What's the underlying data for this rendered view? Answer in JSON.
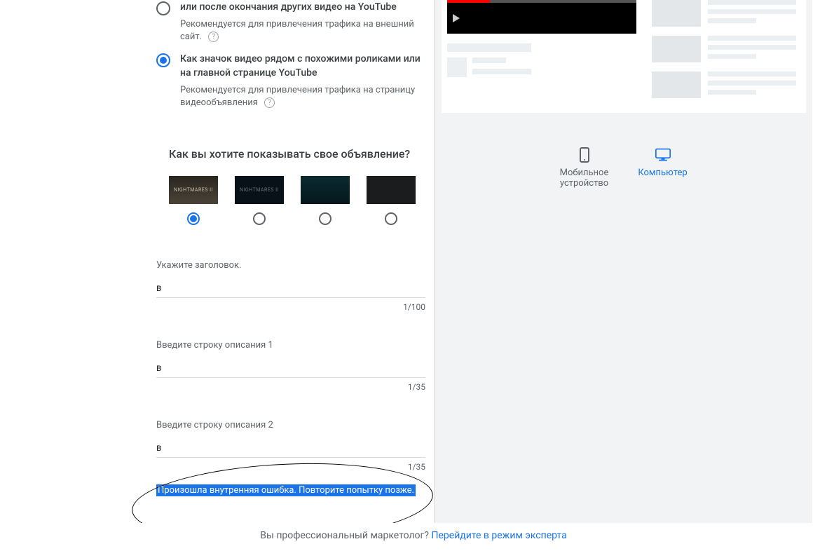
{
  "options": [
    {
      "title": "или после окончания других видео на YouTube",
      "sub": "Рекомендуется для привлечения трафика на внешний сайт."
    },
    {
      "title": "Как значок видео рядом с похожими роликами или на главной странице YouTube",
      "sub": "Рекомендуется для привлечения трафика на страницу видеообъявления"
    }
  ],
  "section_heading": "Как вы хотите показывать свое объявление?",
  "thumbs": [
    {
      "caption": "NIGHTMARES II"
    },
    {
      "caption": "NIGHTMARES II"
    },
    {
      "caption": ""
    },
    {
      "caption": ""
    }
  ],
  "fields": {
    "headline": {
      "label": "Укажите заголовок.",
      "value": "в",
      "counter": "1/100"
    },
    "desc1": {
      "label": "Введите строку описания 1",
      "value": "в",
      "counter": "1/35"
    },
    "desc2": {
      "label": "Введите строку описания 2",
      "value": "в",
      "counter": "1/35"
    }
  },
  "error": "Произошла внутренняя ошибка. Повторите попытку позже.",
  "devices": {
    "mobile": "Мобильное устройство",
    "desktop": "Компьютер"
  },
  "footer": {
    "question": "Вы профессиональный маркетолог? ",
    "link": "Перейдите в режим эксперта"
  },
  "help_glyph": "?"
}
